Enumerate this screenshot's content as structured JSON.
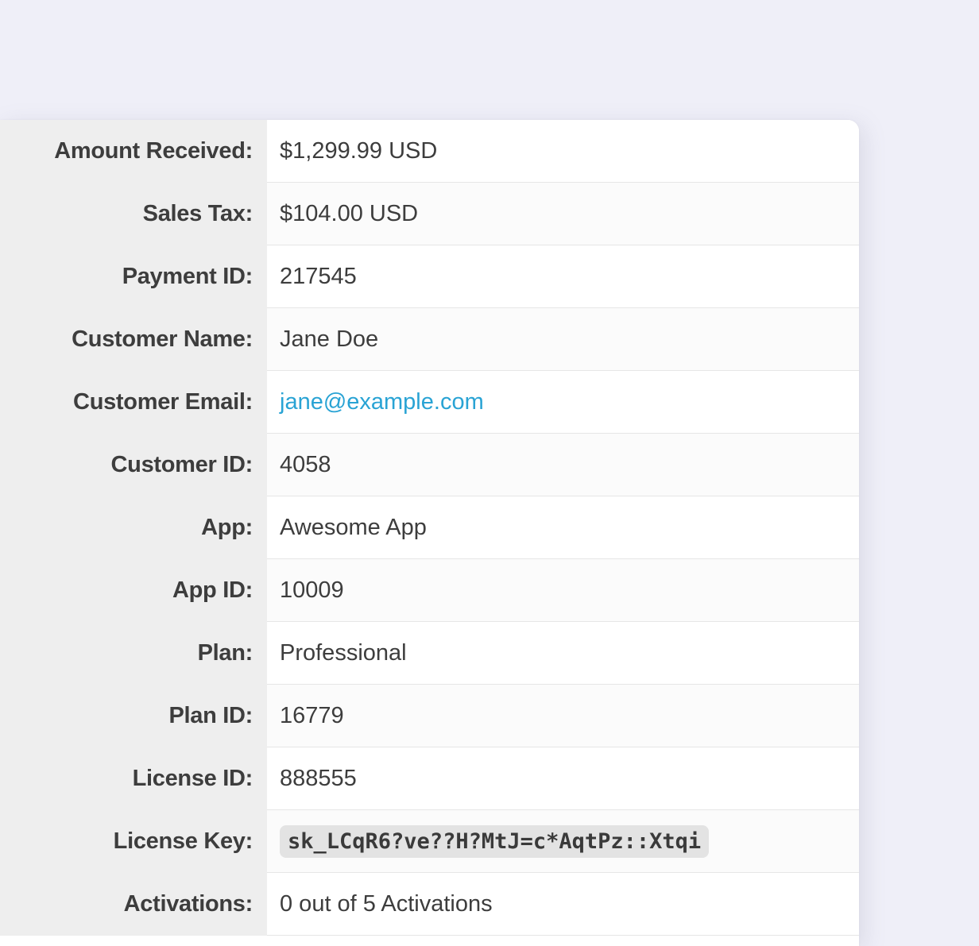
{
  "details": {
    "rows": [
      {
        "label": "Amount Received:",
        "value": "$1,299.99 USD"
      },
      {
        "label": "Sales Tax:",
        "value": "$104.00 USD"
      },
      {
        "label": "Payment ID:",
        "value": "217545"
      },
      {
        "label": "Customer Name:",
        "value": "Jane Doe"
      },
      {
        "label": "Customer Email:",
        "value": "jane@example.com"
      },
      {
        "label": "Customer ID:",
        "value": "4058"
      },
      {
        "label": "App:",
        "value": "Awesome App"
      },
      {
        "label": "App ID:",
        "value": "10009"
      },
      {
        "label": "Plan:",
        "value": "Professional"
      },
      {
        "label": "Plan ID:",
        "value": "16779"
      },
      {
        "label": "License ID:",
        "value": "888555"
      },
      {
        "label": "License Key:",
        "value": "sk_LCqR6?ve??H?MtJ=c*AqtPz::Xtqi"
      },
      {
        "label": "Activations:",
        "value": "0 out of 5 Activations"
      }
    ]
  },
  "colors": {
    "page_background": "#efeff8",
    "label_background": "#eeeeee",
    "link": "#29a3d4",
    "text": "#3d3d3d"
  }
}
